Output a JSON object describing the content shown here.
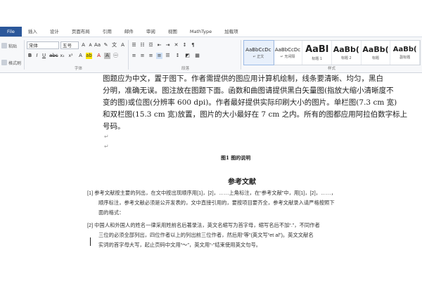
{
  "ribbon": {
    "tabs": [
      "File",
      "插入",
      "设计",
      "页面布局",
      "引用",
      "邮件",
      "审阅",
      "视图",
      "MathType",
      "加载项"
    ],
    "clipboard": [
      "粘贴",
      "格式刷"
    ],
    "font_name": "宋体",
    "font_size": "五号",
    "group_labels": {
      "font": "字体",
      "paragraph": "段落",
      "styles": "样式"
    },
    "styles": [
      {
        "sample": "AaBbCcDc",
        "name": "↵ 正文"
      },
      {
        "sample": "AaBbCcDc",
        "name": "↵ 无间隔"
      },
      {
        "sample": "AaBl",
        "name": "标题 1"
      },
      {
        "sample": "AaBb(",
        "name": "标题 2"
      },
      {
        "sample": "AaBb(",
        "name": "标题"
      },
      {
        "sample": "AaBb(",
        "name": "副标题"
      }
    ]
  },
  "document": {
    "body_lines": [
      "图题应为中文，置于图下。作者需提供的图应用计算机绘制，线条要清晰、均匀，黑白",
      "分明，准确无误。图注放在图题下面。函数和曲图请提供黑白矢量图(指放大缩小清晰度不",
      "变的图)或位图(分辨率 600 dpi)。作者最好提供实际印刷大小的图片。单栏图(7.3 cm 宽)",
      "和双栏图(15.3 cm 宽)放置，图片的大小最好在 7 cm 之内。所有的图都应用阿拉伯数字标上",
      "号码。"
    ],
    "figure_caption": "图1  图的说明",
    "references_heading": "参考文献",
    "ref_lines": [
      "[1] 参考文献按主要的列出，在文中按出现顺序用[1]，[2]，……上角标注，在“参考文献”中，用[1]，[2]，……，",
      "顺序标注，参考文献必须是公开发表的，文中直接引用的，要按项目要齐全，参考文献录入请严格按照下",
      "面的格式：",
      "[2] 中国人和外国人的姓名一律采用姓前名后著录法，英文名缩写为首字母，缩写名后不加“.”，不同作者",
      "三位的必须全部列出，四位作者以上的列出前三位作者，然后用“等”(英文写“et al”)。英文文献名",
      "实词的首字母大写，起止页码中文用“～”，英文用“-”结束使用英文句号。"
    ]
  }
}
